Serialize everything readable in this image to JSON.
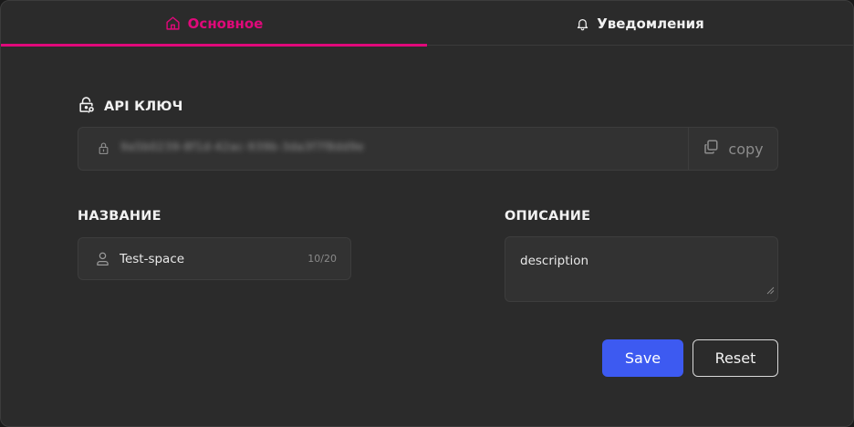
{
  "tabs": [
    {
      "label": "Основное",
      "icon": "home-icon",
      "active": true
    },
    {
      "label": "Уведомления",
      "icon": "bell-icon",
      "active": false
    }
  ],
  "api_key": {
    "title": "API КЛЮЧ",
    "value": "9a5b0239-8f1d-42ac-939b-3da3f7f8dd9e",
    "copy_label": "copy"
  },
  "name_field": {
    "title": "НАЗВАНИЕ",
    "value": "Test-space",
    "counter": "10/20"
  },
  "description_field": {
    "title": "ОПИСАНИЕ",
    "value": "description"
  },
  "actions": {
    "save_label": "Save",
    "reset_label": "Reset"
  },
  "colors": {
    "accent": "#e0097a",
    "primary_button": "#3d5af1",
    "background": "#2b2b2b"
  }
}
